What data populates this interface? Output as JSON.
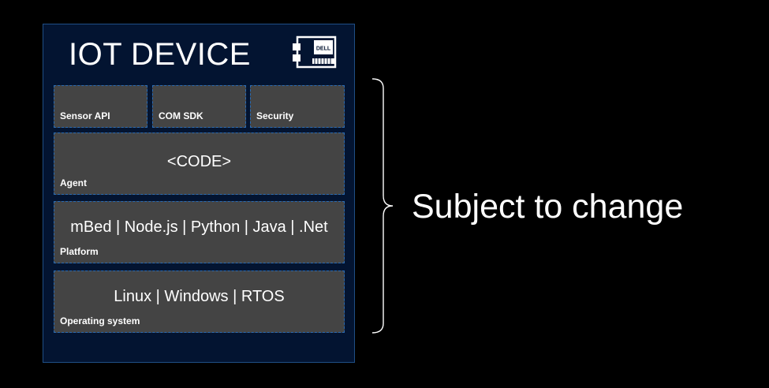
{
  "device": {
    "title": "IOT DEVICE",
    "board_logo_text": "DELL",
    "background_color": "#031431",
    "border_color": "#1f4f86",
    "icon": "dell-board-icon"
  },
  "top_blocks": [
    {
      "label": "Sensor API"
    },
    {
      "label": "COM SDK"
    },
    {
      "label": "Security"
    }
  ],
  "agent": {
    "content": "<CODE>",
    "label": "Agent"
  },
  "platform": {
    "content": "mBed | Node.js | Python | Java | .Net",
    "label": "Platform"
  },
  "os": {
    "content": "Linux | Windows | RTOS",
    "label": "Operating system"
  },
  "annotation": {
    "text": "Subject to change",
    "icon": "right-curly-brace"
  },
  "colors": {
    "block": "#444444",
    "block_border": "#2a6bb3",
    "page_background": "#000000"
  }
}
